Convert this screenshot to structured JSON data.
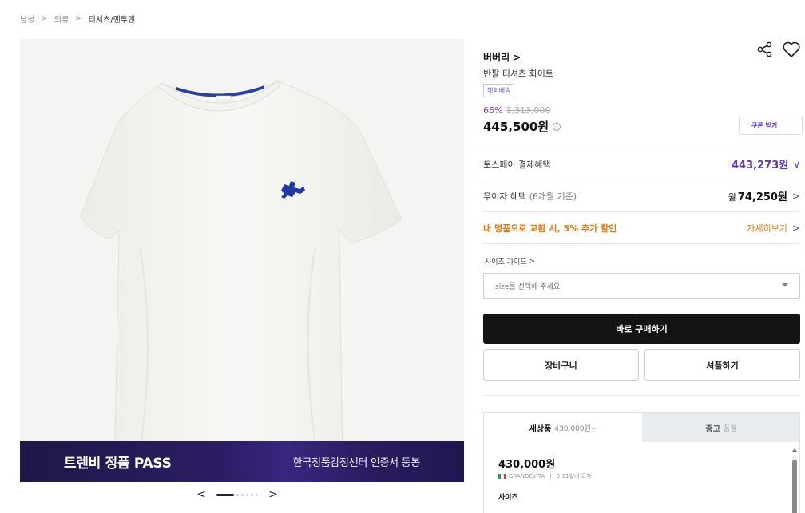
{
  "breadcrumb": {
    "items": [
      "남성",
      "의류",
      "티셔츠/맨투맨"
    ],
    "separator": ">"
  },
  "banner": {
    "left_text": "트렌비 정품 PASS",
    "right_text": "한국정품감정센터 인증서 동봉"
  },
  "carousel": {
    "prev": "<",
    "next": ">",
    "total_slides": 7,
    "active_slide": 1
  },
  "product": {
    "brand": "버버리",
    "brand_arrow": ">",
    "name": "반팔 티셔츠 화이트",
    "shipping_badge": "해외배송",
    "discount": "66%",
    "original_price": "1,313,000",
    "price": "445,500원",
    "info_icon": "i",
    "coupon_button": "쿠폰 받기"
  },
  "benefits": {
    "toss_label": "토스페이 결제혜택",
    "toss_value": "443,273원",
    "toss_chevron": "∨",
    "mooja_label": "무이자 혜택",
    "mooja_label_sub": "(6개월 기준)",
    "mooja_currency": "월",
    "mooja_value": "74,250원",
    "mooja_chevron": ">",
    "exchange_label": "내 명품으로 교환 시, 5% 추가 할인",
    "exchange_link": "자세히보기",
    "exchange_chevron": ">"
  },
  "size": {
    "guide_label": "사이즈 가이드",
    "guide_chevron": ">",
    "select_placeholder": "size를 선택해 주세요."
  },
  "actions": {
    "buy_now": "바로 구매하기",
    "cart": "장바구니",
    "sample": "셔플하기"
  },
  "offers": {
    "tab_new": "새상품",
    "tab_new_sub": "430,000원~",
    "tab_used": "중고",
    "tab_used_sub": "품절",
    "offer_price": "430,000원",
    "seller": "GRANDEVITA",
    "seller_sep": "|",
    "delivery": "9-11일내 도착",
    "size_label": "사이즈"
  },
  "colors": {
    "accent_purple": "#6238b5",
    "discount_purple": "#8a3cc9",
    "orange": "#e07a12",
    "buy_button": "#141414",
    "logo_blue": "#1f3ba3"
  },
  "icons": {
    "share": "share-icon",
    "heart": "heart-icon",
    "chevron": "chevron-right-icon"
  }
}
